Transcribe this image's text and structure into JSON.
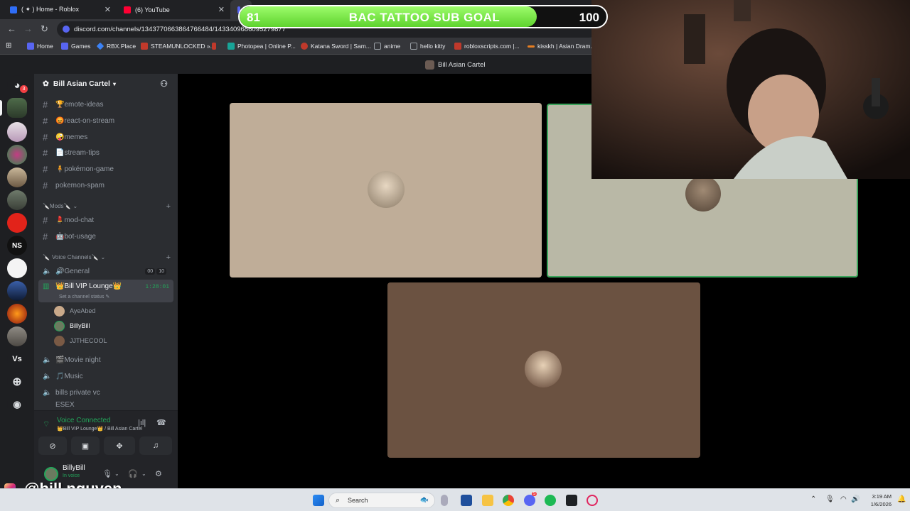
{
  "browser": {
    "tabs": [
      {
        "label": "( ✦ ) Home - Roblox",
        "color": "#2f6df6"
      },
      {
        "label": "(6) YouTube",
        "color": "#ff0033"
      },
      {
        "label": "",
        "color": "#5865f2"
      }
    ],
    "url": "discord.com/channels/1343770663864766484/1433409686095279877",
    "bookmarks": [
      {
        "label": "Home",
        "icon": "discord-icon",
        "color": "#5865f2"
      },
      {
        "label": "Games",
        "icon": "discord-icon",
        "color": "#5865f2"
      },
      {
        "label": "RBX.Place",
        "icon": "diamond-icon",
        "color": "#3b82f6"
      },
      {
        "label": "STEAMUNLOCKED »...",
        "icon": "steam-icon",
        "color": "#c0392b"
      },
      {
        "label": "",
        "icon": "flag-icon",
        "color": "#c0392b"
      },
      {
        "label": "Photopea | Online P...",
        "icon": "photopea-icon",
        "color": "#18a497"
      },
      {
        "label": "Katana Sword | Sam...",
        "icon": "katana-icon",
        "color": "#c0392b"
      },
      {
        "label": "anime",
        "icon": "folder-icon",
        "color": "#9aa0a6"
      },
      {
        "label": "hello kitty",
        "icon": "folder-icon",
        "color": "#9aa0a6"
      },
      {
        "label": "robloxscripts.com |...",
        "icon": "roblox-icon",
        "color": "#c0392b"
      },
      {
        "label": "kisskh | Asian Dram...",
        "icon": "kiss-icon",
        "color": "#e67e22"
      }
    ]
  },
  "sub_goal": {
    "current": "81",
    "title": "BAC TATTOO SUB GOAL",
    "target": "100",
    "progress": 0.81,
    "color": "#7be34b"
  },
  "discord": {
    "window_title": "Bill Asian Cartel",
    "server_name": "Bill Asian Cartel",
    "dm_badge": "3",
    "channels": [
      {
        "name": "emote-ideas",
        "emoji": "🏆"
      },
      {
        "name": "react-on-stream",
        "emoji": "😡"
      },
      {
        "name": "memes",
        "emoji": "🤪"
      },
      {
        "name": "stream-tips",
        "emoji": "📄"
      },
      {
        "name": "pokémon-game",
        "emoji": "🧍"
      },
      {
        "name": "pokemon-spam",
        "emoji": ""
      }
    ],
    "mods_category": "Mods",
    "mod_channels": [
      {
        "name": "mod-chat",
        "emoji": "💄"
      },
      {
        "name": "bot-usage",
        "emoji": "🤖"
      }
    ],
    "voice_category": "Voice Channels",
    "voice_channels": [
      {
        "name": "General",
        "emoji": "🔊",
        "counts": [
          "00",
          "10"
        ]
      },
      {
        "name": "Bill VIP Lounge",
        "emoji": "👑",
        "timer": "1:28:01",
        "status": "Set a channel status"
      },
      {
        "name": "Movie night",
        "emoji": "🎬"
      },
      {
        "name": "Music",
        "emoji": "🎵"
      },
      {
        "name": "bills private vc",
        "emoji": ""
      },
      {
        "name": "ESEX",
        "emoji": ""
      }
    ],
    "members": [
      "AyeAbed",
      "BillyBill",
      "JJTHECOOL"
    ],
    "voice_panel": {
      "status": "Voice Connected",
      "location": "👑Bill VIP Lounge👑 / Bill Asian Cartel"
    },
    "user": {
      "name": "BillyBill",
      "status": "In voice"
    }
  },
  "stream": {
    "instagram": "@bill.nguyen"
  },
  "taskbar": {
    "search_placeholder": "Search",
    "time": "3:19 AM",
    "date": "1/6/2026",
    "discord_badge": "5"
  },
  "colors": {
    "discord_green": "#23a55a",
    "discord_bg": "#2b2d31",
    "blurple": "#5865f2"
  }
}
